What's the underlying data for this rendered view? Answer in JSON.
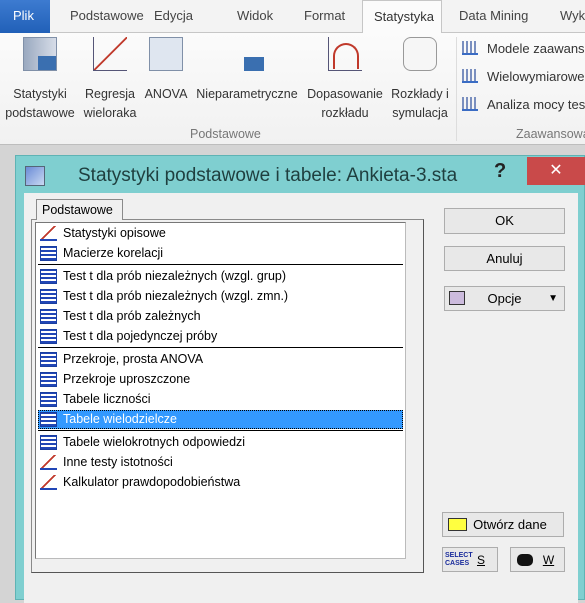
{
  "ribbon": {
    "tabs": [
      "Plik",
      "Podstawowe",
      "Edycja",
      "Widok",
      "Format",
      "Statystyka",
      "Data Mining",
      "Wyk"
    ],
    "active_tab": "Statystyka",
    "buttons": [
      {
        "line1": "Statystyki",
        "line2": "podstawowe",
        "icon": "descriptive-stats-icon"
      },
      {
        "line1": "Regresja",
        "line2": "wieloraka",
        "icon": "regression-scatter-icon"
      },
      {
        "line1": "ANOVA",
        "line2": "",
        "icon": "anova-icon"
      },
      {
        "line1": "Nieparametryczne",
        "line2": "",
        "icon": "nonparametric-icon"
      },
      {
        "line1": "Dopasowanie",
        "line2": "rozkładu",
        "icon": "distribution-fit-icon"
      },
      {
        "line1": "Rozkłady i",
        "line2": "symulacja",
        "icon": "distributions-simulation-icon"
      }
    ],
    "group_basic": "Podstawowe",
    "advanced_items": [
      "Modele zaawans",
      "Wielowymiarowe",
      "Analiza mocy tes"
    ],
    "group_advanced": "Zaawansowa"
  },
  "dialog": {
    "title": "Statystyki podstawowe i tabele: Ankieta-3.sta",
    "help": "?",
    "close": "✕",
    "tab": "Podstawowe",
    "items": [
      "Statystyki opisowe",
      "Macierze korelacji",
      "Test t dla prób niezależnych (wzgl. grup)",
      "Test t dla prób niezależnych (wzgl. zmn.)",
      "Test t dla prób zależnych",
      "Test t dla pojedynczej próby",
      "Przekroje, prosta ANOVA",
      "Przekroje uproszczone",
      "Tabele liczności",
      "Tabele wielodzielcze",
      "Tabele wielokrotnych odpowiedzi",
      "Inne testy istotności",
      "Kalkulator prawdopodobieństwa"
    ],
    "selected": "Tabele wielodzielcze",
    "ok": "OK",
    "cancel": "Anuluj",
    "options": "Opcje",
    "open_data": "Otwórz dane",
    "select_cases_icon_text": "SELECT CASES",
    "s": "S",
    "w": "W"
  }
}
